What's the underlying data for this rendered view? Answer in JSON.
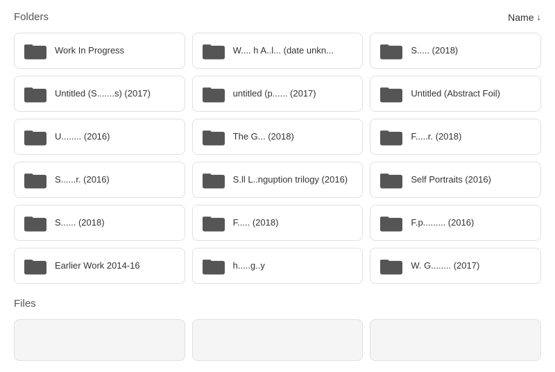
{
  "header": {
    "section_label": "Folders",
    "sort_label": "Name",
    "sort_icon": "↓"
  },
  "folders": [
    {
      "id": 1,
      "name": "Work In Progress"
    },
    {
      "id": 2,
      "name": "W.... h A..l... (date unkn..."
    },
    {
      "id": 3,
      "name": "S..... (2018)"
    },
    {
      "id": 4,
      "name": "Untitled (S.......s) (2017)"
    },
    {
      "id": 5,
      "name": "untitled (p...... (2017)"
    },
    {
      "id": 6,
      "name": "Untitled (Abstract Foil)"
    },
    {
      "id": 7,
      "name": "U........ (2016)"
    },
    {
      "id": 8,
      "name": "The G... (2018)"
    },
    {
      "id": 9,
      "name": "F.....r. (2018)"
    },
    {
      "id": 10,
      "name": "S......r. (2016)"
    },
    {
      "id": 11,
      "name": "S.ll L..nguption trilogy (2016)"
    },
    {
      "id": 12,
      "name": "Self Portraits (2016)"
    },
    {
      "id": 13,
      "name": "S...... (2018)"
    },
    {
      "id": 14,
      "name": "F..... (2018)"
    },
    {
      "id": 15,
      "name": "F.p......... (2016)"
    },
    {
      "id": 16,
      "name": "Earlier Work 2014-16"
    },
    {
      "id": 17,
      "name": "h.....g..y"
    },
    {
      "id": 18,
      "name": "W. G........ (2017)"
    }
  ],
  "files_section": {
    "label": "Files"
  }
}
